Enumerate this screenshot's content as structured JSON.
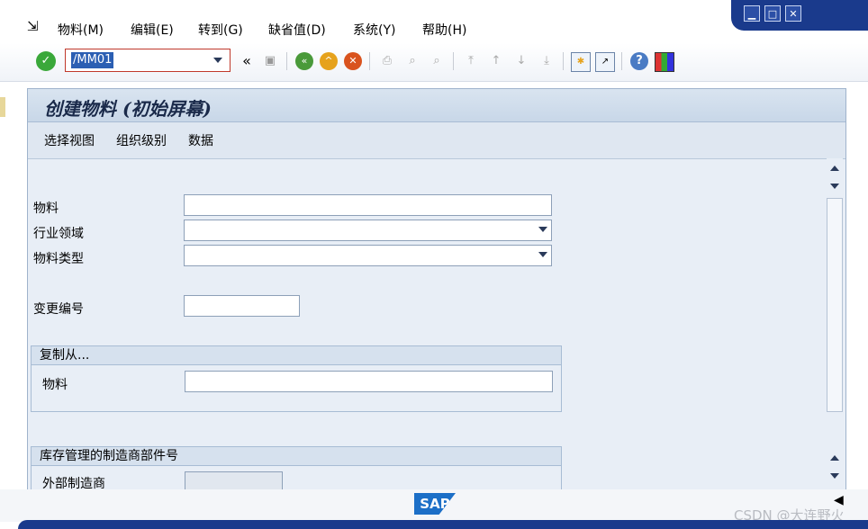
{
  "menubar": {
    "items": [
      "物料(M)",
      "编辑(E)",
      "转到(G)",
      "缺省值(D)",
      "系统(Y)",
      "帮助(H)"
    ]
  },
  "toolbar": {
    "command": "/MM01"
  },
  "screen": {
    "title": "创建物料 (初始屏幕)",
    "app_buttons": [
      "选择视图",
      "组织级别",
      "数据"
    ],
    "fields": {
      "material_label": "物料",
      "industry_label": "行业领域",
      "material_type_label": "物料类型",
      "change_number_label": "变更编号"
    },
    "copy_from": {
      "header": "复制从...",
      "material_label": "物料"
    },
    "mpn": {
      "header": "库存管理的制造商部件号",
      "manufacturer_label": "外部制造商"
    }
  },
  "statusbar": {
    "logo": "SAP",
    "watermark": "CSDN @大连野火"
  },
  "colors": {
    "window_frame": "#1a3a8c",
    "sap_blue": "#1c6fc7",
    "command_highlight": "#2b5fb3"
  }
}
